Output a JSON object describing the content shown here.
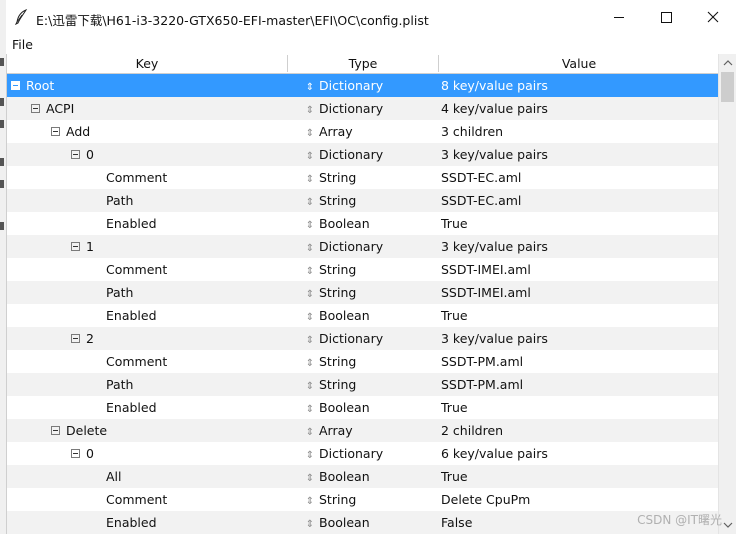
{
  "window": {
    "title": "E:\\迅雷下载\\H61-i3-3220-GTX650-EFI-master\\EFI\\OC\\config.plist"
  },
  "menu": {
    "file": "File"
  },
  "table": {
    "columns": {
      "key": "Key",
      "type": "Type",
      "value": "Value"
    },
    "rows": [
      {
        "key": "Root",
        "depth": 0,
        "expander": "collapse",
        "type": "Dictionary",
        "value": "8 key/value pairs",
        "selected": true
      },
      {
        "key": "ACPI",
        "depth": 1,
        "expander": "collapse",
        "type": "Dictionary",
        "value": "4 key/value pairs"
      },
      {
        "key": "Add",
        "depth": 2,
        "expander": "collapse",
        "type": "Array",
        "value": "3 children"
      },
      {
        "key": "0",
        "depth": 3,
        "expander": "collapse",
        "type": "Dictionary",
        "value": "3 key/value pairs"
      },
      {
        "key": "Comment",
        "depth": 4,
        "expander": "none",
        "type": "String",
        "value": "SSDT-EC.aml"
      },
      {
        "key": "Path",
        "depth": 4,
        "expander": "none",
        "type": "String",
        "value": "SSDT-EC.aml"
      },
      {
        "key": "Enabled",
        "depth": 4,
        "expander": "none",
        "type": "Boolean",
        "value": "True"
      },
      {
        "key": "1",
        "depth": 3,
        "expander": "collapse",
        "type": "Dictionary",
        "value": "3 key/value pairs"
      },
      {
        "key": "Comment",
        "depth": 4,
        "expander": "none",
        "type": "String",
        "value": "SSDT-IMEI.aml"
      },
      {
        "key": "Path",
        "depth": 4,
        "expander": "none",
        "type": "String",
        "value": "SSDT-IMEI.aml"
      },
      {
        "key": "Enabled",
        "depth": 4,
        "expander": "none",
        "type": "Boolean",
        "value": "True"
      },
      {
        "key": "2",
        "depth": 3,
        "expander": "collapse",
        "type": "Dictionary",
        "value": "3 key/value pairs"
      },
      {
        "key": "Comment",
        "depth": 4,
        "expander": "none",
        "type": "String",
        "value": "SSDT-PM.aml"
      },
      {
        "key": "Path",
        "depth": 4,
        "expander": "none",
        "type": "String",
        "value": "SSDT-PM.aml"
      },
      {
        "key": "Enabled",
        "depth": 4,
        "expander": "none",
        "type": "Boolean",
        "value": "True"
      },
      {
        "key": "Delete",
        "depth": 2,
        "expander": "collapse",
        "type": "Array",
        "value": "2 children"
      },
      {
        "key": "0",
        "depth": 3,
        "expander": "collapse",
        "type": "Dictionary",
        "value": "6 key/value pairs"
      },
      {
        "key": "All",
        "depth": 4,
        "expander": "none",
        "type": "Boolean",
        "value": "True"
      },
      {
        "key": "Comment",
        "depth": 4,
        "expander": "none",
        "type": "String",
        "value": "Delete CpuPm"
      },
      {
        "key": "Enabled",
        "depth": 4,
        "expander": "none",
        "type": "Boolean",
        "value": "False"
      }
    ]
  },
  "watermark": "CSDN @IT曙光",
  "colors": {
    "selection": "#3399ff",
    "alt_row": "#f2f2f2"
  }
}
